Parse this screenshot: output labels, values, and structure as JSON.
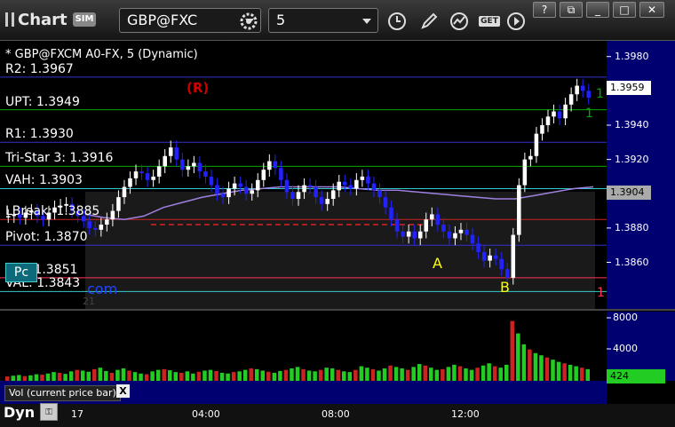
{
  "toolbar": {
    "app_title": "Chart",
    "sim_badge": "SIM",
    "symbol": "GBP@FXC",
    "interval": "5",
    "get_label": "GET"
  },
  "chart": {
    "title": "* GBP@FXCM A0-FX, 5 (Dynamic)",
    "watermark_text": "com",
    "faint_text": "21",
    "levels": [
      {
        "label": "R2: 1.3967",
        "price": 1.3968,
        "color": "#3333cc"
      },
      {
        "label": "UPT: 1.3949",
        "price": 1.3949,
        "color": "#00aa00"
      },
      {
        "label": "R1: 1.3930",
        "price": 1.393,
        "color": "#3333cc"
      },
      {
        "label": "Tri-Star 3: 1.3916",
        "price": 1.3916,
        "color": "#00aa00"
      },
      {
        "label": "VAH: 1.3903",
        "price": 1.3903,
        "color": "#33cccc"
      },
      {
        "label": "LBreak: 1.3885",
        "price": 1.3885,
        "color": "#cc2222"
      },
      {
        "label": "Pivot: 1.3870",
        "price": 1.387,
        "color": "#3333cc"
      },
      {
        "label": "LPT: 1.3851",
        "price": 1.3851,
        "color": "#ff3355"
      },
      {
        "label": "VAL: 1.3843",
        "price": 1.3843,
        "color": "#33cccc"
      }
    ],
    "price_ticks": [
      "1.3980",
      "1.3940",
      "1.3920",
      "1.3900",
      "1.3880",
      "1.3860"
    ],
    "price_tick_values": [
      1.398,
      1.394,
      1.392,
      1.39,
      1.388,
      1.386
    ],
    "last_price": "1.3959",
    "vah_price_box": "1.3904",
    "vol_ticks": [
      "8000",
      "4000"
    ],
    "vol_last": "424",
    "time_ticks": [
      "17",
      "04:00",
      "08:00",
      "12:00"
    ],
    "markers": {
      "r": "(R)",
      "a": "A",
      "b": "B",
      "one_top": "1",
      "one_mid": "1",
      "one_bot": "1"
    },
    "pc_button": "Pc",
    "vol_label": "Vol (current price bar)",
    "close_label": "X",
    "dyn_label": "Dyn",
    "colors": {
      "up": "#ffffff",
      "down": "#2222ff",
      "panel": "#1a1a1a",
      "axis_bg": "#000070"
    }
  },
  "chart_data": {
    "type": "line",
    "ylim": [
      1.3838,
      1.3984
    ],
    "close_series": [
      1.3887,
      1.3888,
      1.3886,
      1.3889,
      1.389,
      1.3887,
      1.3885,
      1.3889,
      1.3892,
      1.3893,
      1.3894,
      1.389,
      1.3887,
      1.3884,
      1.388,
      1.3879,
      1.3882,
      1.3885,
      1.389,
      1.3898,
      1.3904,
      1.3909,
      1.3913,
      1.3912,
      1.3908,
      1.391,
      1.3916,
      1.3922,
      1.3927,
      1.392,
      1.3914,
      1.3916,
      1.3918,
      1.3913,
      1.391,
      1.3905,
      1.39,
      1.3898,
      1.3903,
      1.3906,
      1.3904,
      1.39,
      1.3902,
      1.3908,
      1.3914,
      1.3919,
      1.3915,
      1.3908,
      1.3901,
      1.3897,
      1.3901,
      1.3905,
      1.3904,
      1.3898,
      1.3894,
      1.3897,
      1.3902,
      1.3907,
      1.3905,
      1.3903,
      1.3908,
      1.391,
      1.3906,
      1.3902,
      1.3898,
      1.3892,
      1.3885,
      1.3878,
      1.3875,
      1.3878,
      1.3874,
      1.3878,
      1.3885,
      1.3888,
      1.3882,
      1.3878,
      1.3874,
      1.3877,
      1.3879,
      1.3876,
      1.3871,
      1.3866,
      1.3861,
      1.3864,
      1.3862,
      1.3856,
      1.3851,
      1.3876,
      1.3905,
      1.392,
      1.3922,
      1.3935,
      1.394,
      1.3945,
      1.3948,
      1.3944,
      1.3952,
      1.3958,
      1.3963,
      1.396,
      1.3956
    ],
    "vwap_series": [
      1.3888,
      1.3886,
      1.3885,
      1.3887,
      1.3892,
      1.3895,
      1.3898,
      1.39,
      1.3902,
      1.3903,
      1.3904,
      1.3904,
      1.3904,
      1.3904,
      1.3903,
      1.3902,
      1.3902,
      1.3901,
      1.39,
      1.3899,
      1.3898,
      1.3897,
      1.3897,
      1.3899,
      1.3901,
      1.3903,
      1.3904
    ],
    "volume_series": [
      600,
      700,
      800,
      650,
      750,
      900,
      850,
      1000,
      1200,
      1100,
      950,
      1300,
      1500,
      1400,
      1250,
      1600,
      1800,
      1350,
      1100,
      1500,
      1700,
      1400,
      1200,
      1000,
      900,
      1300,
      1500,
      1600,
      1450,
      1200,
      1100,
      1300,
      1000,
      1250,
      1400,
      1500,
      1350,
      1100,
      1000,
      1200,
      1300,
      1500,
      1700,
      1600,
      1400,
      1250,
      1100,
      1350,
      1500,
      1700,
      1900,
      1600,
      1400,
      1300,
      1500,
      1800,
      1700,
      1500,
      1300,
      1200,
      1500,
      2000,
      1800,
      1600,
      1400,
      1700,
      2100,
      1900,
      1700,
      1500,
      1900,
      2300,
      2100,
      1800,
      1500,
      1600,
      1900,
      2200,
      2000,
      1700,
      1500,
      1800,
      2100,
      2400,
      2000,
      1800,
      2200,
      8200,
      6500,
      5000,
      4300,
      3800,
      3500,
      3200,
      2900,
      2600,
      2400,
      2200,
      2000,
      1800,
      1600
    ]
  }
}
